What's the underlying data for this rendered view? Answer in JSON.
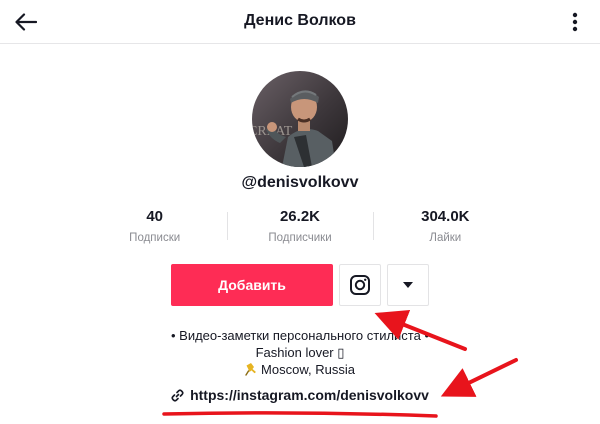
{
  "header": {
    "title": "Денис Волков"
  },
  "profile": {
    "username": "@denisvolkovv"
  },
  "stats": [
    {
      "value": "40",
      "label": "Подписки"
    },
    {
      "value": "26.2K",
      "label": "Подписчики"
    },
    {
      "value": "304.0K",
      "label": "Лайки"
    }
  ],
  "actions": {
    "follow_label": "Добавить"
  },
  "bio": {
    "line1": "• Видео-заметки персонального стилиста •",
    "line2": "Fashion lover ▯",
    "line3": "Moscow, Russia"
  },
  "link": {
    "text": "https://instagram.com/denisvolkovv"
  },
  "avatar_photo_text": "CREAT",
  "colors": {
    "accent": "#fe2c55",
    "annotation": "#e8141c"
  }
}
